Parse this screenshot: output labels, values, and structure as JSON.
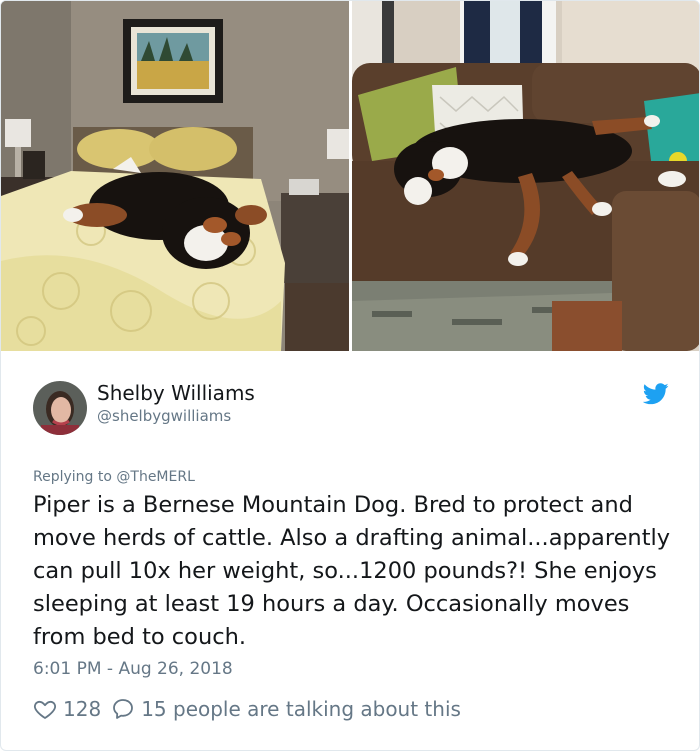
{
  "author": {
    "display_name": "Shelby Williams",
    "handle": "@shelbygwilliams"
  },
  "reply": {
    "prefix": "Replying to ",
    "mention": "@TheMERL"
  },
  "tweet": {
    "text": "Piper is a Bernese Mountain Dog. Bred to protect and move herds of cattle. Also a drafting animal...apparently can pull 10x her weight, so...1200 pounds?! She enjoys sleeping at least 19 hours a day. Occasionally moves from bed to couch.",
    "timestamp": "6:01 PM - Aug 26, 2018"
  },
  "engagement": {
    "likes": "128",
    "conversation": "15 people are talking about this"
  },
  "icons": {
    "brand": "twitter-bird-icon",
    "like": "heart-icon",
    "reply": "speech-bubble-icon"
  },
  "colors": {
    "brand_blue": "#1da1f2",
    "secondary_text": "#657786",
    "primary_text": "#14171a",
    "border": "#e1e8ed"
  }
}
